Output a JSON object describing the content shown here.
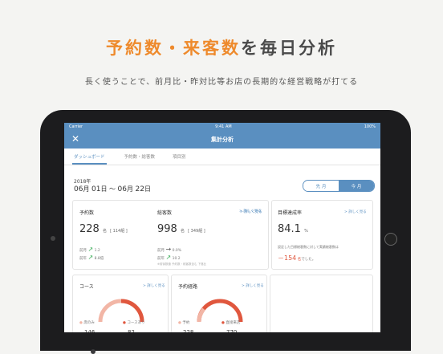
{
  "headline": {
    "part1": "予約数・来客数",
    "part2": "を毎日分析"
  },
  "subline": "長く使うことで、前月比・昨対比等お店の長期的な経営戦略が打てる",
  "status": {
    "carrier": "Carrier",
    "time": "9:41 AM",
    "battery": "100%"
  },
  "nav": {
    "close": "✕",
    "title": "集計分析"
  },
  "tabs": [
    "ダッシュボード",
    "予約数・総客数",
    "項目別"
  ],
  "period": {
    "year": "2018年",
    "start_m": "06",
    "start_d": "01",
    "end_m": "06",
    "end_d": "22",
    "m": "月",
    "d": "日",
    "sep": "〜"
  },
  "segment": {
    "left": "先 月",
    "right": "今 月"
  },
  "reservations": {
    "title": "予約数",
    "more": "> 詳しく見る",
    "value": "228",
    "unit": "名",
    "sub": "[ 114組 ]",
    "prev_month_label": "前月",
    "prev_month_val": "1.2",
    "prev_year_label": "前年",
    "prev_year_val": "8.8倍"
  },
  "visitors": {
    "title": "総客数",
    "more": "> 詳しく見る",
    "value": "998",
    "unit": "名",
    "sub": "[ 349組 ]",
    "prev_month_label": "前月",
    "prev_month_val": "0.0%",
    "prev_year_label": "前年",
    "prev_year_val": "10.2",
    "note": "※前後数値 予約数・総客数含む 下落比"
  },
  "target": {
    "title": "目標達成率",
    "more": "> 詳しく見る",
    "value": "84.1",
    "unit": "%",
    "desc": "設定した目標総客数に対して実績総客数は",
    "shortfall": "－154",
    "shortfall_unit": "名",
    "tail": "でした。"
  },
  "course": {
    "title": "コース",
    "more": "> 詳しく見る",
    "l1": "席のみ",
    "v1": "146",
    "l2": "コースあり",
    "v2": "82"
  },
  "route": {
    "title": "予約経路",
    "more": "> 詳しく見る",
    "l1": "予約",
    "v1": "228",
    "l2": "直接来店",
    "v2": "770"
  },
  "colors": {
    "accent_orange": "#ee8a2c",
    "nav_blue": "#5a8fc0",
    "arc_red": "#e0573e",
    "arc_pink": "#f2b6a6",
    "up_green": "#3cae5a"
  }
}
